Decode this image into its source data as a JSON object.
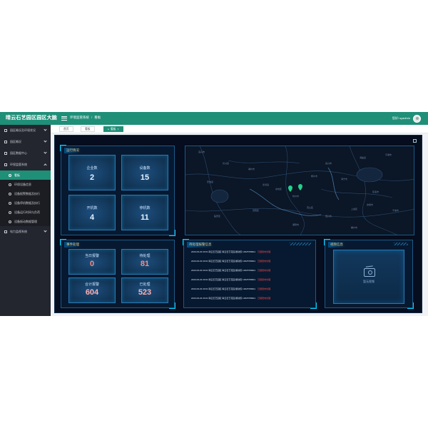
{
  "header": {
    "brand": "晴云石艺园区园区大脑",
    "breadcrumb": [
      "环境监管系统",
      "看板"
    ],
    "user": "您好! syadmin"
  },
  "sidebar": {
    "items": [
      {
        "label": "园区概况及环境状况",
        "open": false
      },
      {
        "label": "园区概况",
        "open": false
      },
      {
        "label": "园区数据中心",
        "open": false
      },
      {
        "label": "环保监管系统",
        "open": true
      },
      {
        "label": "电力监视系统",
        "open": false
      }
    ],
    "subitems": [
      {
        "label": "看板",
        "active": true
      },
      {
        "label": "环保设备信息",
        "active": false
      },
      {
        "label": "设备报警数据及执行",
        "active": false
      },
      {
        "label": "设备停机数据及执行",
        "active": false
      },
      {
        "label": "设备运行时间与负荷",
        "active": false
      },
      {
        "label": "设备振动数据管理",
        "active": false
      }
    ]
  },
  "tabs": [
    {
      "label": "首页",
      "active": false
    },
    {
      "label": "看板",
      "active": false
    },
    {
      "label": "看板",
      "active": true,
      "close": "×"
    }
  ],
  "running": {
    "title": "运行情况",
    "stats": [
      {
        "label": "企业数",
        "value": "2"
      },
      {
        "label": "设备数",
        "value": "15"
      },
      {
        "label": "开机数",
        "value": "4"
      },
      {
        "label": "停机数",
        "value": "11"
      }
    ]
  },
  "events": {
    "title": "事件处理",
    "stats": [
      {
        "label": "当日报警",
        "value": "0"
      },
      {
        "label": "待处理",
        "value": "81"
      },
      {
        "label": "合计报警",
        "value": "604"
      },
      {
        "label": "已处理",
        "value": "523"
      }
    ]
  },
  "alerts": {
    "title": "待处理报警信息",
    "rows": [
      {
        "text": "2020-09-03 00:01   晴云石艺园区   晴云石艺花园 振动值 13625789911",
        "status": "已报警未处理"
      },
      {
        "text": "2020-09-03 00:01   晴云石艺园区   晴云石艺花园 振动值 13625789911",
        "status": "已报警未处理"
      },
      {
        "text": "2020-09-03 00:01   晴云石艺园区   晴云石艺花园 振动值 13625789911",
        "status": "已报警未处理"
      },
      {
        "text": "2020-09-04 00:01   晴云石艺园区   晴云石艺花园 振动值 13625789911",
        "status": "已报警未处理"
      },
      {
        "text": "2020-09-04 00:01   晴云石艺园区   晴云石艺花园 振动值 13625789911",
        "status": "已报警未处理"
      },
      {
        "text": "2020-09-04 00:01   晴云石艺园区   晴云石艺花园 振动值 13625789911",
        "status": "已报警未处理"
      }
    ]
  },
  "video": {
    "title": "视频信息",
    "empty": "暂无视频"
  },
  "map": {
    "labels": [
      "宜兴市",
      "长兴县",
      "湖州市",
      "安吉县",
      "德清县",
      "杭州市",
      "嘉兴市",
      "海宁市",
      "桐乡市",
      "余杭区",
      "萧山区",
      "绍兴市",
      "上虞区",
      "慈溪市",
      "余姚市",
      "宁波市",
      "诸暨市",
      "嵊州市",
      "富阳区",
      "临安区",
      "平湖市",
      "海盐县"
    ]
  },
  "colors": {
    "header": "#1f8f78",
    "sidebar": "#23262e",
    "dashboard": "#050d1e",
    "panel_border": "#1b5a86",
    "accent": "#00d2ff",
    "title": "#e8c77d",
    "alert_status": "#ff4b4b",
    "marker": "#23d18b"
  }
}
